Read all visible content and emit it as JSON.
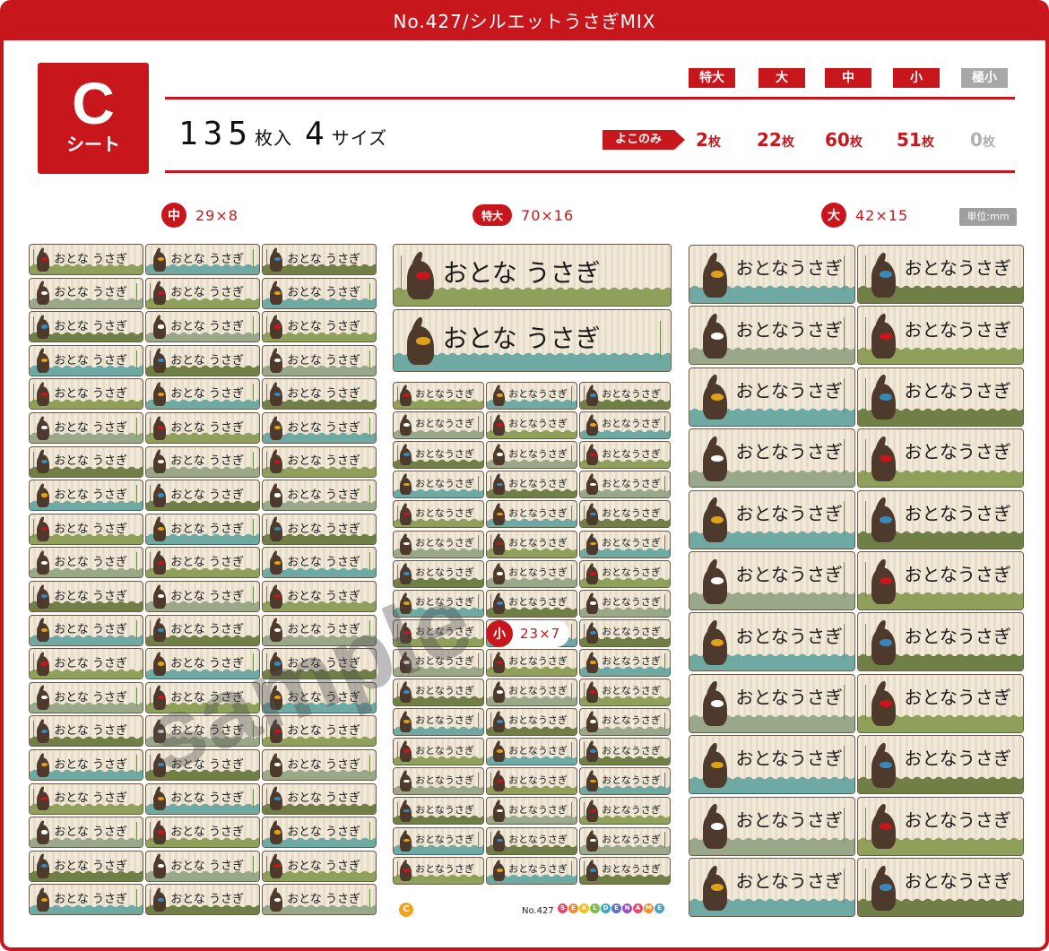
{
  "header": {
    "title": "No.427/シルエットうさぎMIX"
  },
  "sheet": {
    "letter": "C",
    "word": "シート"
  },
  "summary": {
    "count": "135",
    "count_unit": "枚入",
    "sizes": "4",
    "sizes_unit": "サイズ"
  },
  "size_tags": [
    {
      "label": "特大",
      "enabled": true
    },
    {
      "label": "大",
      "enabled": true
    },
    {
      "label": "中",
      "enabled": true
    },
    {
      "label": "小",
      "enabled": true
    },
    {
      "label": "極小",
      "enabled": false
    }
  ],
  "orientation_label": "よこのみ",
  "quantities": [
    {
      "value": "2",
      "unit": "枚",
      "enabled": true
    },
    {
      "value": "22",
      "unit": "枚",
      "enabled": true
    },
    {
      "value": "60",
      "unit": "枚",
      "enabled": true
    },
    {
      "value": "51",
      "unit": "枚",
      "enabled": true
    },
    {
      "value": "0",
      "unit": "枚",
      "enabled": false
    }
  ],
  "sections": {
    "medium": {
      "badge": "中",
      "dim": "29×8"
    },
    "xlarge": {
      "badge": "特大",
      "dim": "70×16"
    },
    "large": {
      "badge": "大",
      "dim": "42×15"
    },
    "small": {
      "badge": "小",
      "dim": "23×7"
    }
  },
  "unit_label": "単位:mm",
  "label_text": {
    "medium": "おとな うさぎ",
    "xlarge": "おとな うさぎ",
    "small": "おとなうさぎ",
    "large": "おとなうさぎ"
  },
  "watermark": "sample",
  "footer": {
    "sheet_mark": "C",
    "number": "No.427",
    "brand": "SEALDENAME"
  },
  "colors": {
    "accent": "#c8161d",
    "disabled": "#a8a8a8",
    "rabbit": "#4e3a2c",
    "grounds": [
      "#8fa05a",
      "#6fa9a4",
      "#6f7f45",
      "#9aa88a"
    ],
    "bows": [
      "#c8161d",
      "#e0a21b",
      "#3a87b8",
      "#ffffff"
    ]
  }
}
